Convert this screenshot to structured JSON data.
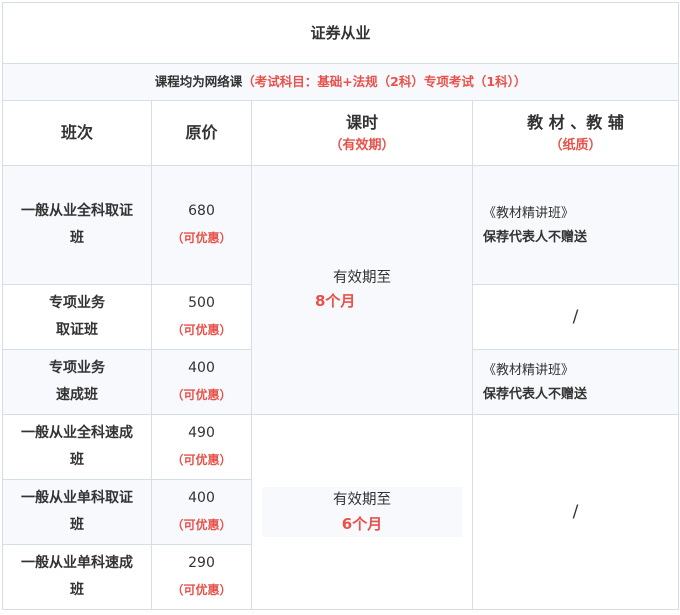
{
  "title": "证券从业",
  "note": {
    "prefix": "课程均为网络课",
    "highlight": "（考试科目：基础+法规（2科）专项考试（1科））"
  },
  "headers": {
    "class": "班次",
    "price": "原价",
    "hours": "课时",
    "hours_sub": "（有效期）",
    "materials": "教 材 、教 辅",
    "materials_sub": "（纸质）"
  },
  "discount_label": "（可优惠）",
  "rows": [
    {
      "name_l1": "一般从业全科取证",
      "name_l2": "班",
      "price": "680"
    },
    {
      "name_l1": "专项业务",
      "name_l2": "取证班",
      "price": "500"
    },
    {
      "name_l1": "专项业务",
      "name_l2": "速成班",
      "price": "400"
    },
    {
      "name_l1": "一般从业全科速成",
      "name_l2": "班",
      "price": "490"
    },
    {
      "name_l1": "一般从业单科取证",
      "name_l2": "班",
      "price": "400"
    },
    {
      "name_l1": "一般从业单科速成",
      "name_l2": "班",
      "price": "290"
    }
  ],
  "validity": [
    {
      "label": "有效期至",
      "value": "8个月"
    },
    {
      "label": "有效期至",
      "value": "6个月"
    }
  ],
  "materials": {
    "book": "《教材精讲班》",
    "note": "保荐代表人不赠送",
    "none": "/"
  }
}
